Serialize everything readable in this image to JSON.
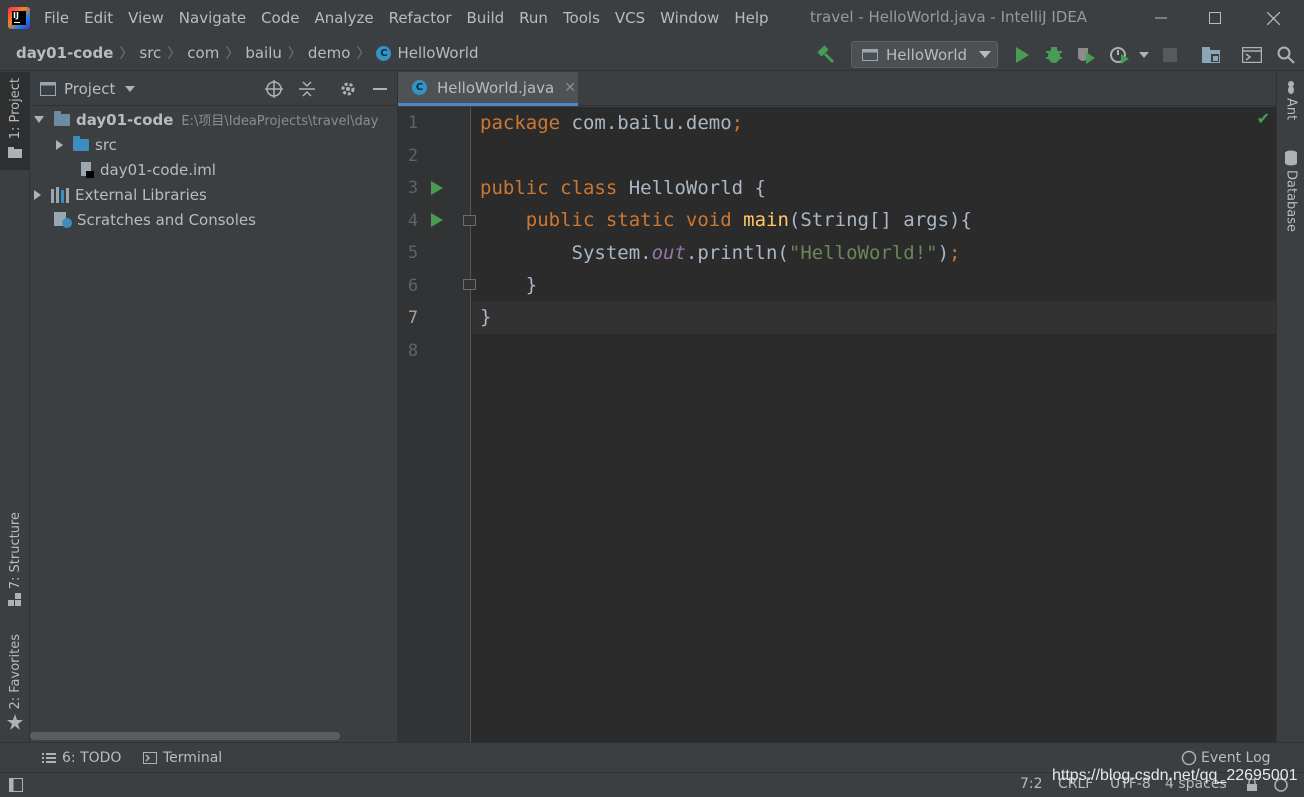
{
  "menu": [
    "File",
    "Edit",
    "View",
    "Navigate",
    "Code",
    "Analyze",
    "Refactor",
    "Build",
    "Run",
    "Tools",
    "VCS",
    "Window",
    "Help"
  ],
  "window_title": "travel - HelloWorld.java - IntelliJ IDEA",
  "breadcrumb": [
    "day01-code",
    "src",
    "com",
    "bailu",
    "demo",
    "HelloWorld"
  ],
  "run_config": "HelloWorld",
  "side_tabs": {
    "project": "1: Project",
    "structure": "7: Structure",
    "favorites": "2: Favorites",
    "ant": "Ant",
    "database": "Database"
  },
  "project_panel": {
    "title": "Project",
    "tree": [
      {
        "label": "day01-code",
        "path": "E:\\项目\\IdeaProjects\\travel\\day"
      },
      {
        "label": "src"
      },
      {
        "label": "day01-code.iml"
      },
      {
        "label": "External Libraries"
      },
      {
        "label": "Scratches and Consoles"
      }
    ]
  },
  "editor": {
    "tab": "HelloWorld.java",
    "line_numbers": [
      "1",
      "2",
      "3",
      "4",
      "5",
      "6",
      "7",
      "8"
    ],
    "code": {
      "l1_kw": "package",
      "l1_rest": " com.bailu.demo",
      "l1_semi": ";",
      "l3_kw": "public class",
      "l3_rest": " HelloWorld {",
      "l4_kw": "public static void",
      "l4_fn": "main",
      "l4_rest": "(String[] args){",
      "l5_pre": "System.",
      "l5_field": "out",
      "l5_mid": ".println(",
      "l5_str": "\"HelloWorld!\"",
      "l5_end": ")",
      "l5_semi": ";",
      "l6": "}",
      "l7": "}"
    }
  },
  "bottom_bar": {
    "todo": "6: TODO",
    "terminal": "Terminal",
    "event_log": "Event Log"
  },
  "status": {
    "position": "7:2",
    "line_sep": "CRLF",
    "encoding": "UTF-8",
    "indent": "4 spaces"
  },
  "watermark": "https://blog.csdn.net/qq_22695001"
}
